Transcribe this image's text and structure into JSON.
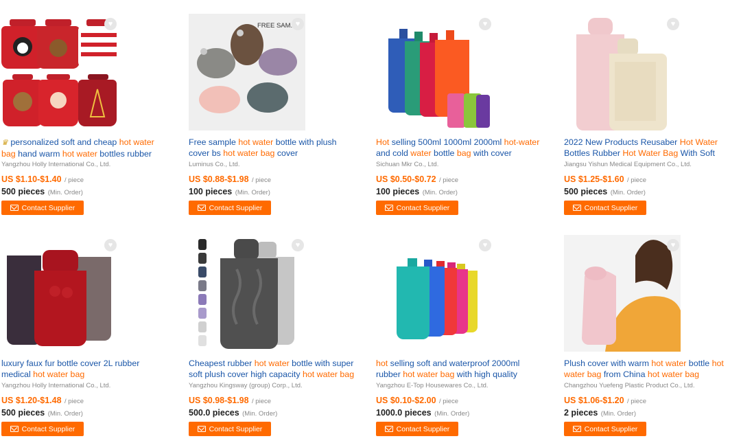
{
  "ui": {
    "price_unit": "/ piece",
    "moq_unit": "(Min. Order)",
    "contact_label": "Contact Supplier",
    "colors": {
      "accent": "#ff6a00",
      "title": "#1a56a8",
      "muted": "#888888"
    }
  },
  "products": [
    {
      "title_line1": [
        "personalized soft and cheap ",
        "hot water"
      ],
      "title_line2": [
        "bag",
        " hand warm ",
        "hot water",
        " bottles rubber"
      ],
      "badge_icon": "crown-icon",
      "company": "Yangzhou Holly International Co., Ltd.",
      "price": "US $1.10-$1.40",
      "moq": "500 pieces",
      "image_label": ""
    },
    {
      "title_line1": [
        "Free sample ",
        "hot water",
        " bottle with plush"
      ],
      "title_line2": [
        "cover bs ",
        "hot water bag",
        " cover"
      ],
      "company": "Luminus Co., Ltd.",
      "price": "US $0.88-$1.98",
      "moq": "100 pieces",
      "image_label": "FREE SAM..."
    },
    {
      "title_line1": [
        "Hot",
        " selling 500ml 1000ml 2000ml ",
        "hot-water"
      ],
      "title_line2": [
        "and cold ",
        "water",
        " bottle ",
        "bag",
        " with cover"
      ],
      "company": "Sichuan Mkr Co., Ltd.",
      "price": "US $0.50-$0.72",
      "moq": "100 pieces",
      "image_label": ""
    },
    {
      "title_line1": [
        "2022 New Products Reusaber ",
        "Hot Water"
      ],
      "title_line2": [
        "Bottles Rubber ",
        "Hot Water Bag",
        " With Soft"
      ],
      "company": "Jiangsu Yishun Medical Equipment Co., Ltd.",
      "price": "US $1.25-$1.60",
      "moq": "500 pieces",
      "image_label": ""
    },
    {
      "title_line1": [
        "luxury faux fur bottle cover 2L rubber"
      ],
      "title_line2": [
        "medical ",
        "hot water bag"
      ],
      "company": "Yangzhou Holly International Co., Ltd.",
      "price": "US $1.20-$1.48",
      "moq": "500 pieces",
      "image_label": ""
    },
    {
      "title_line1": [
        "Cheapest rubber ",
        "hot water",
        " bottle with super"
      ],
      "title_line2": [
        "soft plush cover high capacity ",
        "hot water bag"
      ],
      "company": "Yangzhou Kingsway (group) Corp., Ltd.",
      "price": "US $0.98-$1.98",
      "moq": "500.0 pieces",
      "image_label": ""
    },
    {
      "title_line1": [
        "hot",
        " selling soft and waterproof 2000ml"
      ],
      "title_line2": [
        "rubber ",
        "hot water bag",
        " with high quality"
      ],
      "company": "Yangzhou E-Top Housewares Co., Ltd.",
      "price": "US $0.10-$2.00",
      "moq": "1000.0 pieces",
      "image_label": ""
    },
    {
      "title_line1": [
        "Plush cover with warm ",
        "hot water",
        " bottle ",
        "hot"
      ],
      "title_line2": [
        "water bag",
        " from China ",
        "hot water bag"
      ],
      "company": "Changzhou Yuefeng Plastic Product Co., Ltd.",
      "price": "US $1.06-$1.20",
      "moq": "2 pieces",
      "image_label": ""
    }
  ]
}
